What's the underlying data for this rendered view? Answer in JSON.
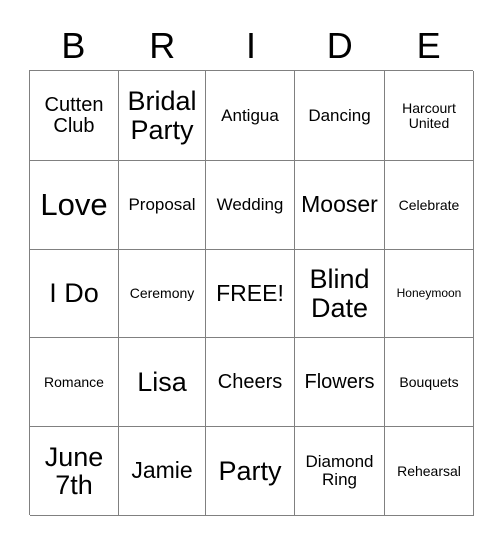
{
  "card": {
    "title_letters": [
      "B",
      "R",
      "I",
      "D",
      "E"
    ],
    "free_space_label": "FREE!",
    "grid_line_color": "#808080",
    "text_color": "#000000",
    "background_color": "#ffffff",
    "rows": [
      [
        {
          "text": "Cutten Club",
          "size": "lg"
        },
        {
          "text": "Bridal Party",
          "size": "2xl"
        },
        {
          "text": "Antigua",
          "size": "md"
        },
        {
          "text": "Dancing",
          "size": "md"
        },
        {
          "text": "Harcourt United",
          "size": "sm"
        }
      ],
      [
        {
          "text": "Love",
          "size": "3xl"
        },
        {
          "text": "Proposal",
          "size": "md"
        },
        {
          "text": "Wedding",
          "size": "md"
        },
        {
          "text": "Mooser",
          "size": "xl"
        },
        {
          "text": "Celebrate",
          "size": "sm"
        }
      ],
      [
        {
          "text": "I Do",
          "size": "2xl"
        },
        {
          "text": "Ceremony",
          "size": "sm"
        },
        {
          "text": "FREE!",
          "size": "xl"
        },
        {
          "text": "Blind Date",
          "size": "2xl"
        },
        {
          "text": "Honeymoon",
          "size": "xs"
        }
      ],
      [
        {
          "text": "Romance",
          "size": "sm"
        },
        {
          "text": "Lisa",
          "size": "2xl"
        },
        {
          "text": "Cheers",
          "size": "lg"
        },
        {
          "text": "Flowers",
          "size": "lg"
        },
        {
          "text": "Bouquets",
          "size": "sm"
        }
      ],
      [
        {
          "text": "June 7th",
          "size": "2xl"
        },
        {
          "text": "Jamie",
          "size": "xl"
        },
        {
          "text": "Party",
          "size": "2xl"
        },
        {
          "text": "Diamond Ring",
          "size": "md"
        },
        {
          "text": "Rehearsal",
          "size": "sm"
        }
      ]
    ]
  }
}
